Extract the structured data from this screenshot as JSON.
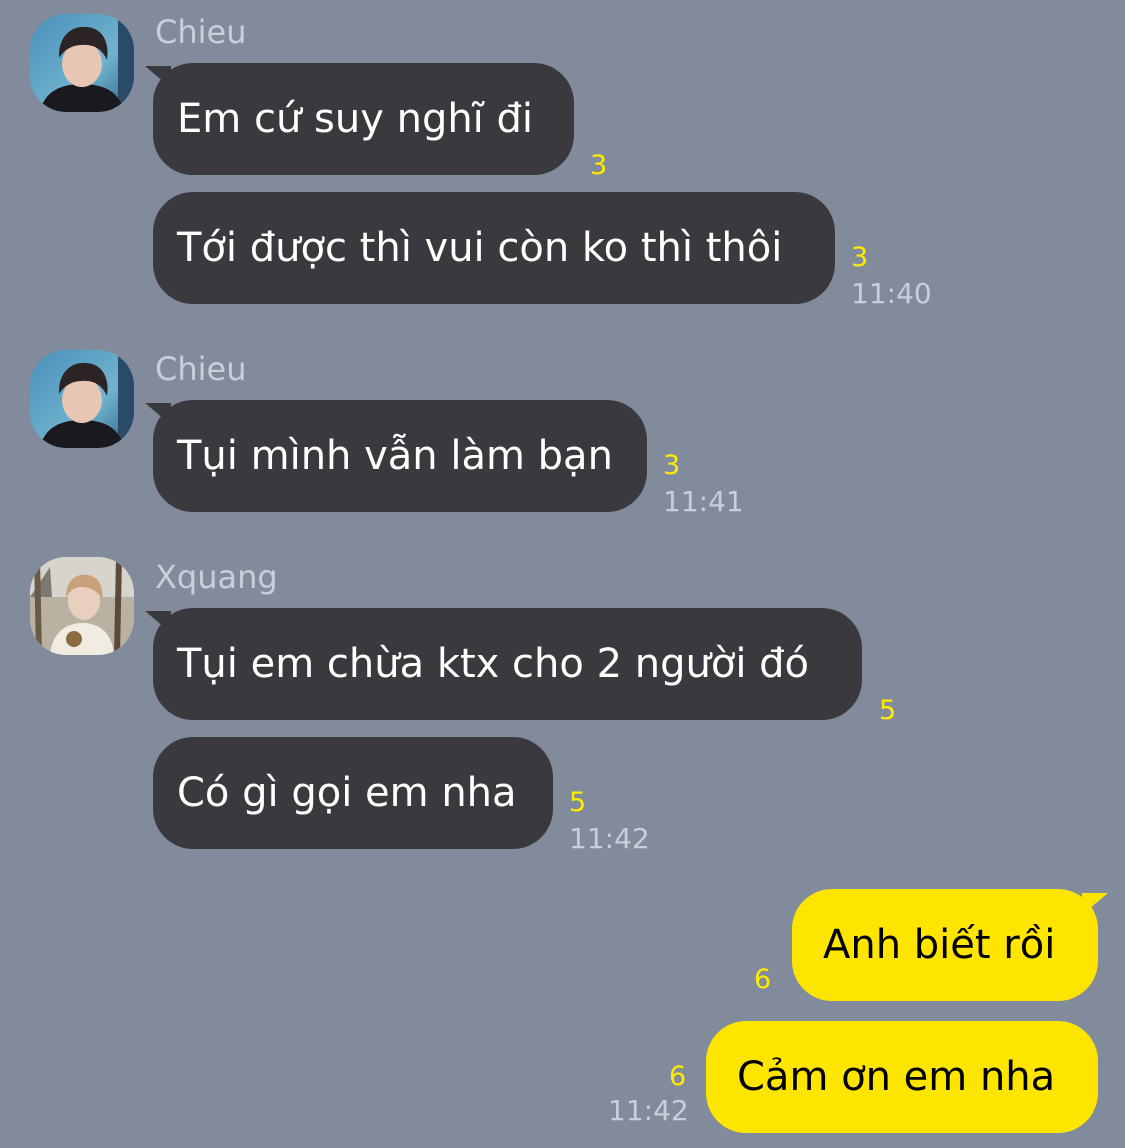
{
  "colors": {
    "background": "#818b9c",
    "incoming_bubble": "#3a3a3e",
    "outgoing_bubble": "#fee500",
    "unread_count": "#ffeb00",
    "meta_text": "#c9cfd9"
  },
  "groups": [
    {
      "sender": "Chieu",
      "avatar_icon": "profile-photo-icon",
      "messages": [
        {
          "text": "Em cứ suy nghĩ đi",
          "unread": "3"
        },
        {
          "text": "Tới được thì vui còn ko thì thôi",
          "unread": "3",
          "time": "11:40"
        }
      ]
    },
    {
      "sender": "Chieu",
      "avatar_icon": "profile-photo-icon",
      "messages": [
        {
          "text": "Tụi mình vẫn làm bạn",
          "unread": "3",
          "time": "11:41"
        }
      ]
    },
    {
      "sender": "Xquang",
      "avatar_icon": "profile-photo-icon",
      "messages": [
        {
          "text": "Tụi em chừa ktx cho 2 người đó",
          "unread": "5"
        },
        {
          "text": "Có gì gọi em nha",
          "unread": "5",
          "time": "11:42"
        }
      ]
    }
  ],
  "outgoing": [
    {
      "text": "Anh biết rồi",
      "unread": "6"
    },
    {
      "text": "Cảm ơn em nha",
      "unread": "6",
      "time": "11:42"
    }
  ]
}
